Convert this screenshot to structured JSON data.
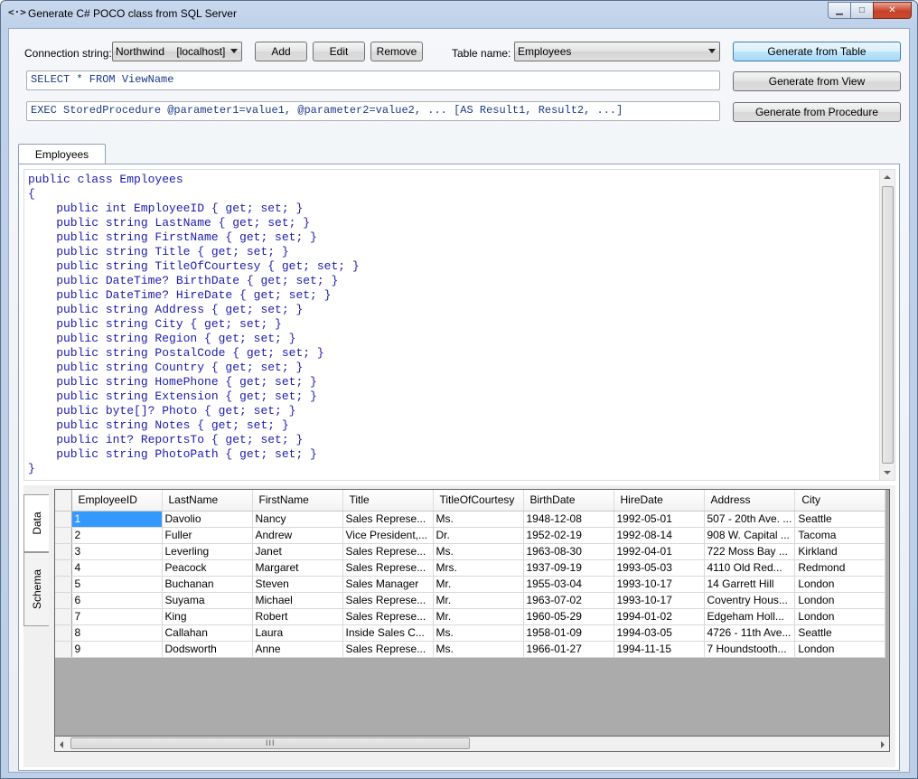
{
  "window": {
    "icon_text": "<·>",
    "title": "Generate C# POCO class from SQL Server"
  },
  "connection": {
    "label": "Connection string:",
    "selected": "Northwind    [localhost]",
    "add_label": "Add",
    "edit_label": "Edit",
    "remove_label": "Remove"
  },
  "table": {
    "label": "Table name:",
    "selected": "Employees"
  },
  "actions": {
    "from_table": "Generate from Table",
    "from_view": "Generate from View",
    "from_procedure": "Generate from Procedure"
  },
  "queries": {
    "view_sql": "SELECT * FROM ViewName",
    "procedure_sql": "EXEC StoredProcedure @parameter1=value1, @parameter2=value2, ... [AS Result1, Result2, ...]"
  },
  "result_tab": "Employees",
  "code_lines": [
    "public class Employees",
    "{",
    "    public int EmployeeID { get; set; }",
    "    public string LastName { get; set; }",
    "    public string FirstName { get; set; }",
    "    public string Title { get; set; }",
    "    public string TitleOfCourtesy { get; set; }",
    "    public DateTime? BirthDate { get; set; }",
    "    public DateTime? HireDate { get; set; }",
    "    public string Address { get; set; }",
    "    public string City { get; set; }",
    "    public string Region { get; set; }",
    "    public string PostalCode { get; set; }",
    "    public string Country { get; set; }",
    "    public string HomePhone { get; set; }",
    "    public string Extension { get; set; }",
    "    public byte[]? Photo { get; set; }",
    "    public string Notes { get; set; }",
    "    public int? ReportsTo { get; set; }",
    "    public string PhotoPath { get; set; }",
    "}"
  ],
  "side_tabs": {
    "data": "Data",
    "schema": "Schema"
  },
  "grid": {
    "columns": [
      "EmployeeID",
      "LastName",
      "FirstName",
      "Title",
      "TitleOfCourtesy",
      "BirthDate",
      "HireDate",
      "Address",
      "City"
    ],
    "rows": [
      [
        "1",
        "Davolio",
        "Nancy",
        "Sales Represe...",
        "Ms.",
        "1948-12-08",
        "1992-05-01",
        "507 - 20th Ave. ...",
        "Seattle"
      ],
      [
        "2",
        "Fuller",
        "Andrew",
        "Vice President,...",
        "Dr.",
        "1952-02-19",
        "1992-08-14",
        "908 W. Capital ...",
        "Tacoma"
      ],
      [
        "3",
        "Leverling",
        "Janet",
        "Sales Represe...",
        "Ms.",
        "1963-08-30",
        "1992-04-01",
        "722 Moss Bay ...",
        "Kirkland"
      ],
      [
        "4",
        "Peacock",
        "Margaret",
        "Sales Represe...",
        "Mrs.",
        "1937-09-19",
        "1993-05-03",
        "4110 Old Red...",
        "Redmond"
      ],
      [
        "5",
        "Buchanan",
        "Steven",
        "Sales Manager",
        "Mr.",
        "1955-03-04",
        "1993-10-17",
        "14 Garrett Hill",
        "London"
      ],
      [
        "6",
        "Suyama",
        "Michael",
        "Sales Represe...",
        "Mr.",
        "1963-07-02",
        "1993-10-17",
        "Coventry Hous...",
        "London"
      ],
      [
        "7",
        "King",
        "Robert",
        "Sales Represe...",
        "Mr.",
        "1960-05-29",
        "1994-01-02",
        "Edgeham Holl...",
        "London"
      ],
      [
        "8",
        "Callahan",
        "Laura",
        "Inside Sales C...",
        "Ms.",
        "1958-01-09",
        "1994-03-05",
        "4726 - 11th Ave...",
        "Seattle"
      ],
      [
        "9",
        "Dodsworth",
        "Anne",
        "Sales Represe...",
        "Ms.",
        "1966-01-27",
        "1994-11-15",
        "7 Houndstooth...",
        "London"
      ]
    ]
  },
  "hscroll_grip": "III",
  "colors": {
    "code_text": "#1b1bb0",
    "selection": "#3399ff",
    "sql_text": "#1a3a8a"
  }
}
